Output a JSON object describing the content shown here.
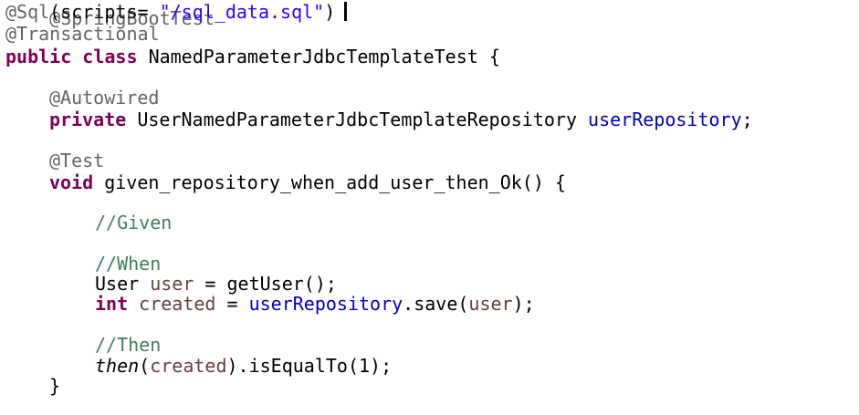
{
  "code": {
    "clipped_line": "@SpringBootTest",
    "sql_annotation": "@Sql",
    "sql_open": "(scripts= ",
    "sql_string": "\"/sql_data.sql\"",
    "sql_close": ")",
    "transactional": "@Transactional",
    "kw_public": "public",
    "kw_class": "class",
    "class_name": "NamedParameterJdbcTemplateTest",
    "open_brace": "{",
    "autowired": "@Autowired",
    "kw_private": "private",
    "repo_type": "UserNamedParameterJdbcTemplateRepository",
    "repo_field": "userRepository",
    "semicolon": ";",
    "test_annotation": "@Test",
    "kw_void": "void",
    "method_signature": "given_repository_when_add_user_then_Ok() {",
    "comment_given": "//Given",
    "comment_when": "//When",
    "user_type": "User",
    "user_var": "user",
    "assign": " = ",
    "get_user_call": "getUser();",
    "kw_int": "int",
    "created_var": "created",
    "repo_ref": "userRepository",
    "save_call_open": ".save(",
    "save_arg": "user",
    "save_call_close": ");",
    "comment_then": "//Then",
    "then_call": "then",
    "paren_open": "(",
    "then_arg": "created",
    "is_equal_to": ").isEqualTo(1);",
    "close_brace": "}"
  },
  "colors": {
    "keyword": "#7f0055",
    "string": "#2a00ff",
    "comment": "#3f7f5f",
    "annotation": "#646464",
    "field": "#0000c0",
    "local_variable": "#6a3e3e"
  }
}
